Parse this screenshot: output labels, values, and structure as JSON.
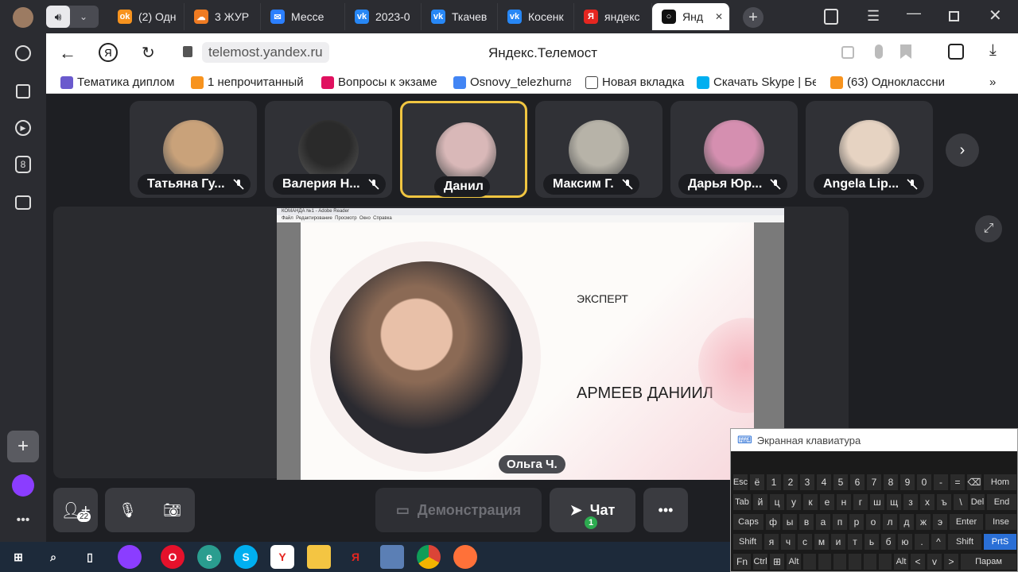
{
  "browser_tabs": [
    {
      "label": "(2) Одн",
      "color": "#f7931e",
      "icon": "ok-icon",
      "glyph": "ok"
    },
    {
      "label": "3 ЖУР",
      "color": "#ef7b22",
      "icon": "cloud-icon",
      "glyph": "☁"
    },
    {
      "label": "Мессе",
      "color": "#2b7fff",
      "icon": "message-icon",
      "glyph": "✉"
    },
    {
      "label": "2023-0",
      "color": "#2787f5",
      "icon": "vk-icon",
      "glyph": "vk"
    },
    {
      "label": "Ткачев",
      "color": "#2787f5",
      "icon": "vk-icon",
      "glyph": "vk"
    },
    {
      "label": "Косенк",
      "color": "#2787f5",
      "icon": "vk-icon",
      "glyph": "vk"
    },
    {
      "label": "яндекс",
      "color": "#e52620",
      "icon": "yandex-icon",
      "glyph": "Я"
    },
    {
      "label": "Янд",
      "color": "#111111",
      "icon": "telemost-icon",
      "glyph": "○"
    }
  ],
  "address": {
    "url": "telemost.yandex.ru",
    "page_title": "Яндекс.Телемост"
  },
  "bookmarks": [
    {
      "label": "Тематика диплом",
      "color": "#6a5acd"
    },
    {
      "label": "1 непрочитанный",
      "color": "#f7931e"
    },
    {
      "label": "Вопросы к экзаме",
      "color": "#e0115f"
    },
    {
      "label": "Osnovy_telezhurna",
      "color": "#4285f4"
    },
    {
      "label": "Новая вкладка",
      "color": "#ffffff"
    },
    {
      "label": "Скачать Skype | Бе",
      "color": "#00aff0"
    },
    {
      "label": "(63) Одноклассни",
      "color": "#f7931e"
    }
  ],
  "participants": [
    {
      "name": "Татьяна Гу...",
      "avatar": "#c9a27a"
    },
    {
      "name": "Валерия Н...",
      "avatar": "#2a2a2a"
    },
    {
      "name": "Данил",
      "avatar": "#d9b8b8"
    },
    {
      "name": "Максим Г.",
      "avatar": "#b7b3a8"
    },
    {
      "name": "Дарья Юр...",
      "avatar": "#d58fb0"
    },
    {
      "name": "Angela Lip...",
      "avatar": "#e6d3c2"
    }
  ],
  "presentation": {
    "window_title": "КОМАНДА №1 - Adobe Reader",
    "menu": "Файл  Редактирование  Просмотр  Окно  Справка",
    "role": "ЭКСПЕРТ",
    "person": "АРМЕЕВ ДАНИИЛ",
    "presenter": "Ольга Ч."
  },
  "controls": {
    "participants_count": "22",
    "demo_label": "Демонстрация",
    "chat_label": "Чат",
    "chat_badge": "1"
  },
  "osk": {
    "title": "Экранная клавиатура"
  },
  "osk_rows": [
    [
      "Esc",
      "ё",
      "1",
      "2",
      "3",
      "4",
      "5",
      "6",
      "7",
      "8",
      "9",
      "0",
      "-",
      "=",
      "⌫",
      "Hom"
    ],
    [
      "Tab",
      "й",
      "ц",
      "у",
      "к",
      "е",
      "н",
      "г",
      "ш",
      "щ",
      "з",
      "х",
      "ъ",
      "\\",
      "Del",
      "End"
    ],
    [
      "Caps",
      "ф",
      "ы",
      "в",
      "а",
      "п",
      "р",
      "о",
      "л",
      "д",
      "ж",
      "э",
      "Enter",
      "Inse"
    ],
    [
      "Shift",
      "я",
      "ч",
      "с",
      "м",
      "и",
      "т",
      "ь",
      "б",
      "ю",
      ".",
      "^",
      "Shift",
      "PrtS"
    ],
    [
      "Fn",
      "Ctrl",
      "⊞",
      "Alt",
      "",
      "",
      "",
      "",
      "",
      "",
      "Alt",
      "<",
      "v",
      ">",
      "Парам"
    ]
  ],
  "colors": {
    "accent": "#f0c541",
    "browser_dark": "#2b2c31"
  }
}
